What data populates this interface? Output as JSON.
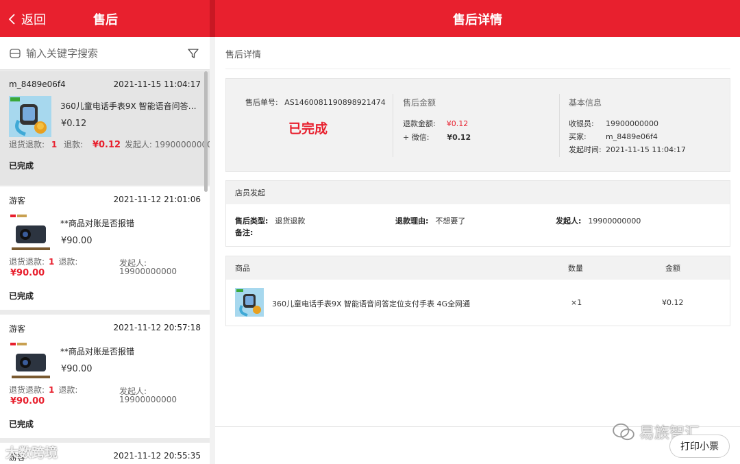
{
  "header": {
    "back_label": "返回",
    "left_title": "售后",
    "right_title": "售后详情"
  },
  "search": {
    "placeholder": "输入关键字搜索"
  },
  "list": [
    {
      "user": "m_8489e06f4",
      "time": "2021-11-15 11:04:17",
      "product": "360儿童电话手表9X 智能语音问答定…",
      "price": "¥0.12",
      "type_label": "退货退款:",
      "qty": "1",
      "refund_label": "退款:",
      "refund": "¥0.12",
      "initiator_label": "发起人:",
      "initiator": "19900000000",
      "status": "已完成"
    },
    {
      "user": "游客",
      "time": "2021-11-12 21:01:06",
      "product": "**商品对账是否报错",
      "price": "¥90.00",
      "type_label": "退货退款:",
      "qty": "1",
      "refund_label": "退款:",
      "refund": "¥90.00",
      "initiator_label": "发起人:",
      "initiator": "19900000000",
      "status": "已完成"
    },
    {
      "user": "游客",
      "time": "2021-11-12 20:57:18",
      "product": "**商品对账是否报错",
      "price": "¥90.00",
      "type_label": "退货退款:",
      "qty": "1",
      "refund_label": "退款:",
      "refund": "¥90.00",
      "initiator_label": "发起人:",
      "initiator": "19900000000",
      "status": "已完成"
    },
    {
      "user": "游客",
      "time": "2021-11-12 20:55:35"
    }
  ],
  "detail": {
    "section_title": "售后详情",
    "order_no_label": "售后单号:",
    "order_no": "AS1460081190898921474",
    "status": "已完成",
    "amount_title": "售后金额",
    "refund_amount_label": "退款金额:",
    "refund_amount": "¥0.12",
    "wechat_label": "+ 微信:",
    "wechat_amount": "¥0.12",
    "basic_title": "基本信息",
    "cashier_label": "收银员:",
    "cashier": "19900000000",
    "buyer_label": "买家:",
    "buyer": "m_8489e06f4",
    "time_label": "发起时间:",
    "time": "2021-11-15 11:04:17",
    "staff_title": "店员发起",
    "type_label": "售后类型:",
    "type": "退货退款",
    "reason_label": "退款理由:",
    "reason": "不想要了",
    "initiator_label": "发起人:",
    "initiator": "19900000000",
    "remark_label": "备注:",
    "goods_col": "商品",
    "qty_col": "数量",
    "amount_col": "金额",
    "goods_name": "360儿童电话手表9X 智能语音问答定位支付手表 4G全网通",
    "goods_qty": "×1",
    "goods_amount": "¥0.12"
  },
  "print_label": "打印小票",
  "watermark_right": "易族智汇",
  "watermark_left": "大数跨境",
  "colors": {
    "brand": "#e8202e"
  }
}
